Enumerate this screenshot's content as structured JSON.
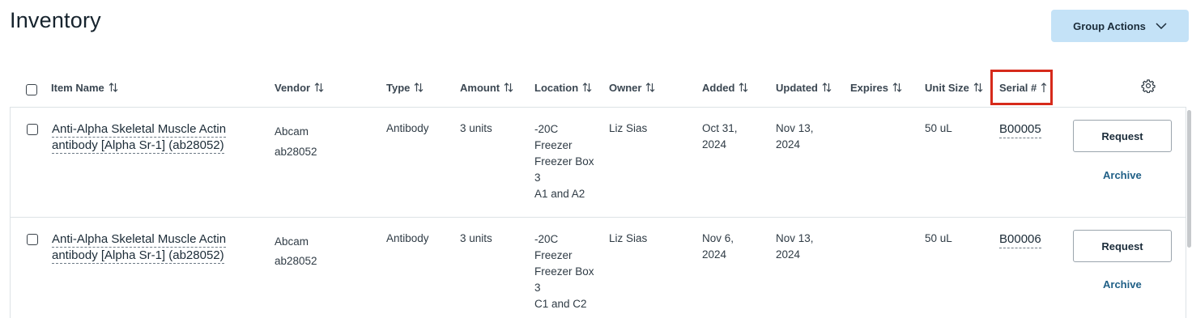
{
  "page": {
    "title": "Inventory"
  },
  "header": {
    "group_actions_label": "Group Actions"
  },
  "table": {
    "columns": {
      "item_name": "Item Name",
      "vendor": "Vendor",
      "type": "Type",
      "amount": "Amount",
      "location": "Location",
      "owner": "Owner",
      "added": "Added",
      "updated": "Updated",
      "expires": "Expires",
      "unit_size": "Unit Size",
      "serial": "Serial #"
    },
    "rows": [
      {
        "name_line1": "Anti-Alpha Skeletal Muscle Actin",
        "name_line2": "antibody [Alpha Sr-1] (ab28052)",
        "vendor": "Abcam",
        "vendor_cat": "ab28052",
        "type": "Antibody",
        "amount": "3 units",
        "location": [
          "-20C",
          "Freezer",
          "Freezer Box",
          "3",
          "A1 and A2"
        ],
        "owner": "Liz Sias",
        "added_line1": "Oct 31,",
        "added_line2": "2024",
        "updated_line1": "Nov 13,",
        "updated_line2": "2024",
        "expires": "",
        "unit_size": "50 uL",
        "serial": "B00005",
        "request_label": "Request",
        "archive_label": "Archive"
      },
      {
        "name_line1": "Anti-Alpha Skeletal Muscle Actin",
        "name_line2": "antibody [Alpha Sr-1] (ab28052)",
        "vendor": "Abcam",
        "vendor_cat": "ab28052",
        "type": "Antibody",
        "amount": "3 units",
        "location": [
          "-20C",
          "Freezer",
          "Freezer Box",
          "3",
          "C1 and C2"
        ],
        "owner": "Liz Sias",
        "added_line1": "Nov 6,",
        "added_line2": "2024",
        "updated_line1": "Nov 13,",
        "updated_line2": "2024",
        "expires": "",
        "unit_size": "50 uL",
        "serial": "B00006",
        "request_label": "Request",
        "archive_label": "Archive"
      }
    ]
  },
  "colors": {
    "accent_button": "#c4e2f7",
    "link": "#1f5f86",
    "highlight": "#d62a1b"
  },
  "sort": {
    "active_column": "serial",
    "direction": "ascending"
  }
}
